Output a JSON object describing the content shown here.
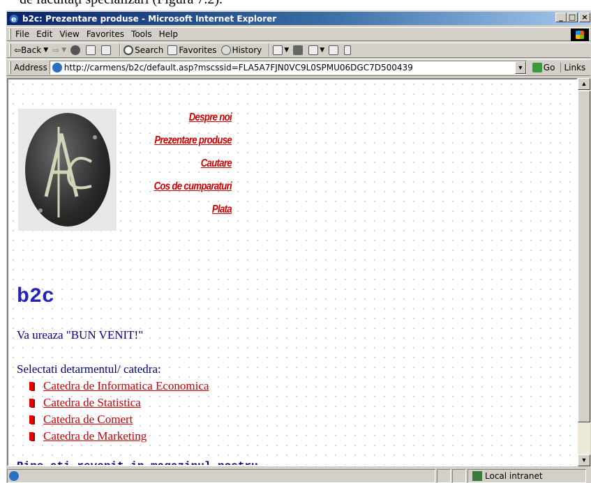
{
  "document_caption": "de facultăţi specializări (Figura 7.2).",
  "window": {
    "title": "b2c: Prezentare produse - Microsoft Internet Explorer",
    "buttons": {
      "minimize": "_",
      "maximize": "□",
      "close": "×"
    }
  },
  "menu": [
    "File",
    "Edit",
    "View",
    "Favorites",
    "Tools",
    "Help"
  ],
  "toolbar": {
    "back": "Back",
    "search": "Search",
    "favorites": "Favorites",
    "history": "History"
  },
  "address": {
    "label": "Address",
    "url": "http://carmens/b2c/default.asp?mscssid=FLA5A7FJN0VC9L0SPMU06DGC7D500439",
    "go": "Go",
    "links": "Links"
  },
  "nav": [
    "Despre noi",
    "Prezentare produse",
    "Cautare",
    "Cos de cumparaturi",
    "Plata"
  ],
  "site_title": "b2c",
  "welcome": "Va ureaza \"BUN VENIT!\"",
  "select_label": "Selectati detarmentul/ catedra:",
  "departments": [
    "Catedra de Informatica Economica",
    "Catedra de Statistica",
    "Catedra de Comert",
    "Catedra de Marketing"
  ],
  "footer_message": "Bine ati revenit in magazinul nostru.",
  "status": {
    "zone": "Local intranet"
  },
  "colors": {
    "title_bar": "#0a246a",
    "nav_link": "#cc0000",
    "site_title": "#2222bb",
    "body_text": "#000080"
  }
}
